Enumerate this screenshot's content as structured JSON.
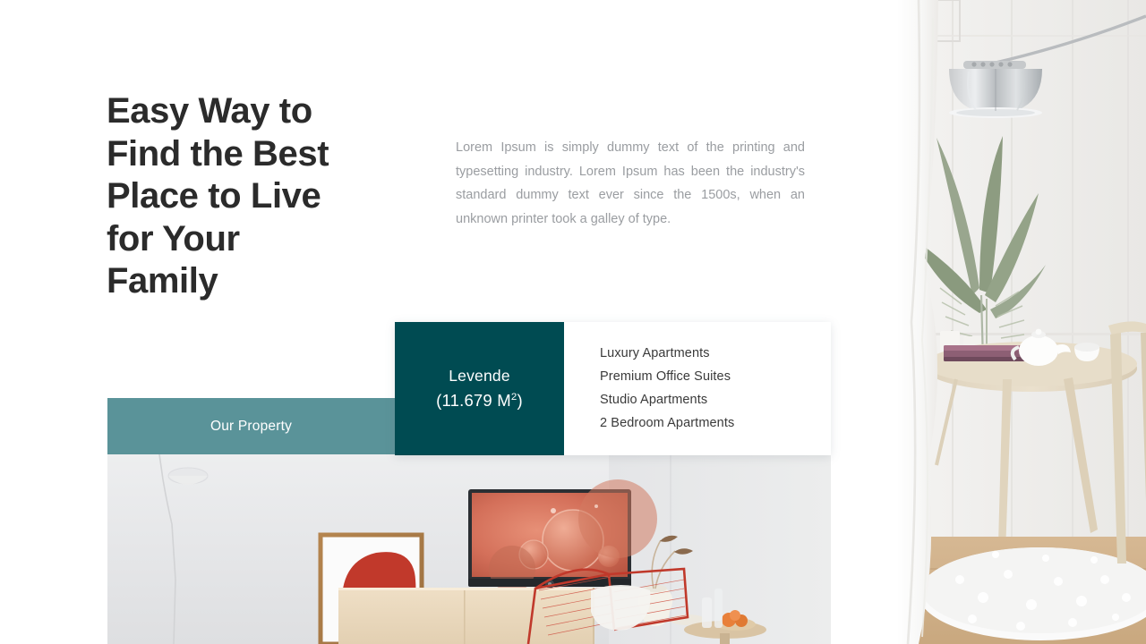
{
  "slide": {
    "background_color": "#ffffff",
    "headline": "Easy Way to\nFind the Best\nPlace to Live\nfor Your\nFamily",
    "paragraph": "Lorem Ipsum is simply dummy text of the printing and typesetting industry.  Lorem Ipsum has been the industry's standard dummy text ever since the 1500s, when an unknown printer took a galley of type."
  },
  "ribbon": {
    "label": "Our Property",
    "color": "#5a9399"
  },
  "info_card": {
    "metric": {
      "name": "Levende",
      "area_prefix": "(11.679 M",
      "area_superscript": "2",
      "area_suffix": ")",
      "background_color": "#004b52"
    },
    "amenities": [
      "Luxury Apartments",
      "Premium Office Suites",
      "Studio Apartments",
      "2 Bedroom Apartments"
    ]
  },
  "photos": {
    "bottom": {
      "alt": "Living room interior with framed red abstract artwork, flat-screen TV showing orange bubbles, light wood cabinet, white vase with dried stems and a red wire mesh lounge chair beside a small side table with oranges"
    },
    "right": {
      "alt": "Bright interior corner with arc floor lamp, silver dome shade, palm plant in glass vase, round wooden table with teapot and book, shag rug and white curtain"
    }
  },
  "text_colors": {
    "headline": "#2b2b2b",
    "paragraph": "#9a9da1",
    "amenity": "#3a3a3a",
    "on_teal": "#ffffff"
  }
}
